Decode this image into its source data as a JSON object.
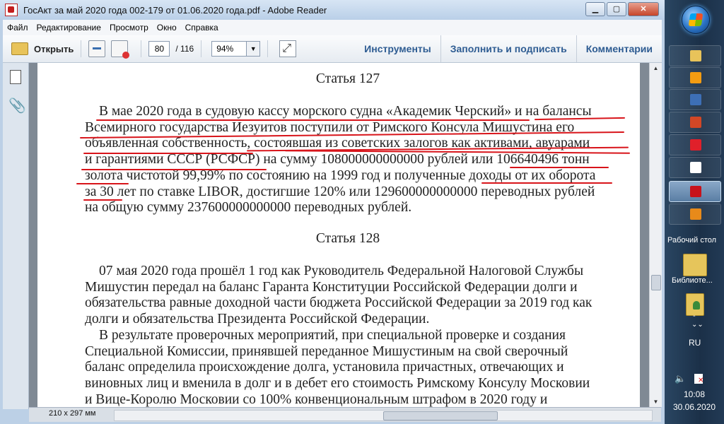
{
  "window": {
    "title": "ГосАкт за май 2020 года 002-179 от 01.06.2020 года.pdf - Adobe Reader",
    "controls": {
      "minimize": "▁",
      "maximize": "▢",
      "close": "✕"
    }
  },
  "menu": [
    "Файл",
    "Редактирование",
    "Просмотр",
    "Окно",
    "Справка"
  ],
  "toolbar": {
    "open_label": "Открыть",
    "page_current": "80",
    "page_total": "/ 116",
    "zoom": "94%",
    "right_links": [
      "Инструменты",
      "Заполнить и подписать",
      "Комментарии"
    ]
  },
  "document": {
    "heading_127": "Статья 127",
    "para_127": [
      "В мае 2020 года в судовую кассу морского судна «Академик Черский» и на балансы",
      "Всемирного государства Иезуитов поступили от Римского Консула Мишустина его",
      "объявленная собственность, состоявшая из советских залогов как активами, авуарами",
      "и гарантиями СССР (РСФСР) на сумму 108000000000000 рублей или 106640496 тонн",
      "золота чистотой 99,99% по состоянию на 1999 год и полученные доходы от их оборота",
      "за 30 лет по ставке LIBOR, достигшие 120% или 129600000000000 переводных рублей",
      "на общую сумму 237600000000000 переводных рублей."
    ],
    "heading_128": "Статья 128",
    "para_128a": [
      "07 мая 2020 года прошёл 1 год как Руководитель Федеральной Налоговой Службы",
      "Мишустин передал на баланс Гаранта Конституции Российской Федерации долги и",
      "обязательства равные доходной части бюджета Российской Федерации за 2019 год как",
      "долги и обязательства Президента Российской Федерации."
    ],
    "para_128b": [
      "В результате проверочных мероприятий, при специальной проверке и создания",
      "Специальной Комиссии, принявшей переданное Мишустиным на свой сверочный",
      "баланс определила происхождение долга, установила причастных, отвечающих и",
      "виновных лиц и вменила в долг и в дебет его стоимость Римскому Консулу Московии",
      "и Вице-Королю Московии со 100% конвенциональным штрафом в 2020 году и"
    ]
  },
  "status": {
    "page_size": "210 x 297 мм"
  },
  "taskbar": {
    "desktop_label": "Рабочий стол",
    "library_label": "Библиоте...",
    "user_label": "-",
    "language": "RU",
    "time": "10:08",
    "date": "30.06.2020",
    "buttons": [
      {
        "name": "explorer",
        "color": "#e8c35a"
      },
      {
        "name": "media-player",
        "color": "#f39c12"
      },
      {
        "name": "save-disk",
        "color": "#3d6fb6"
      },
      {
        "name": "powerpoint",
        "color": "#d24726"
      },
      {
        "name": "opera",
        "color": "#e0202a"
      },
      {
        "name": "yandex-browser",
        "color": "#ffffff"
      },
      {
        "name": "adobe-reader",
        "color": "#c8121b"
      },
      {
        "name": "settings-app",
        "color": "#e88a1a"
      }
    ]
  },
  "accent_colors": {
    "underline": "#d8141a",
    "link": "#2e5c92"
  }
}
